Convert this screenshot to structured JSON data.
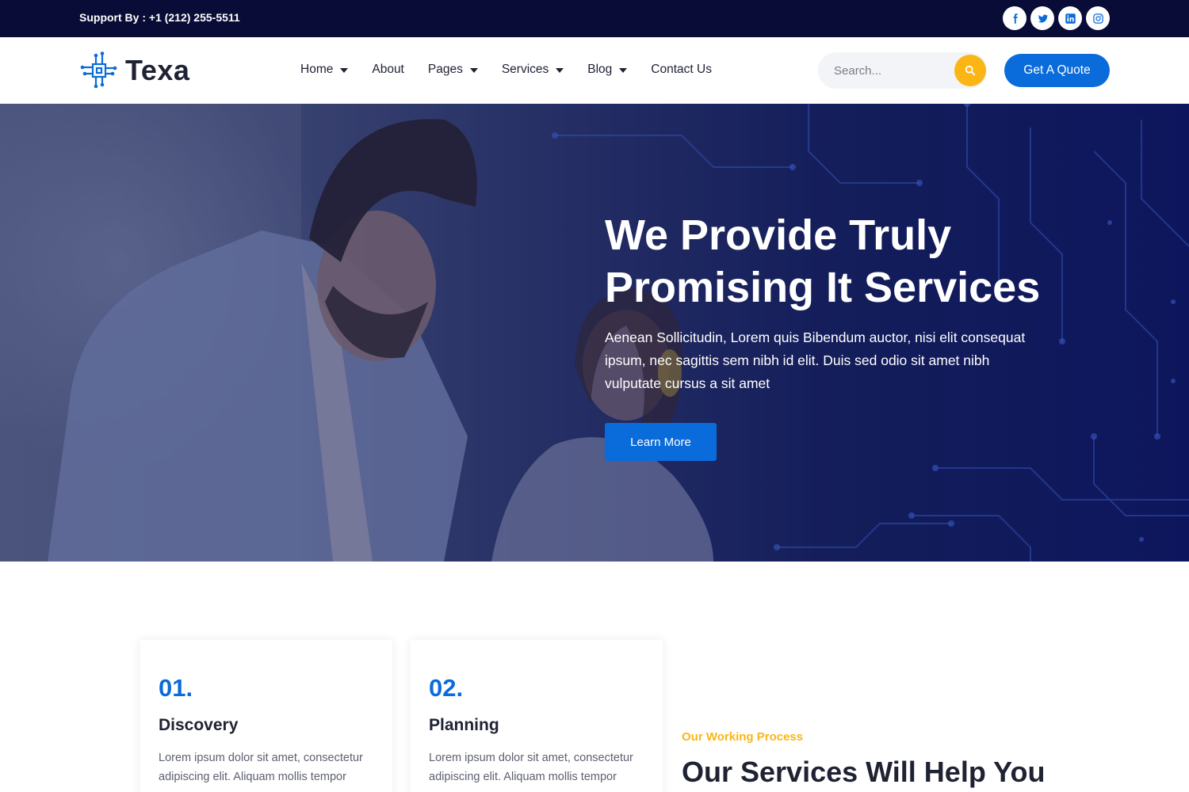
{
  "topbar": {
    "support": "Support By : +1 (212) 255-5511",
    "socials": [
      "facebook-icon",
      "twitter-icon",
      "linkedin-icon",
      "instagram-icon"
    ]
  },
  "nav": {
    "logo_text": "Texa",
    "menu": [
      {
        "label": "Home",
        "dropdown": true
      },
      {
        "label": "About",
        "dropdown": false
      },
      {
        "label": "Pages",
        "dropdown": true
      },
      {
        "label": "Services",
        "dropdown": true
      },
      {
        "label": "Blog",
        "dropdown": true
      },
      {
        "label": "Contact Us",
        "dropdown": false
      }
    ],
    "search_placeholder": "Search...",
    "quote_label": "Get A Quote"
  },
  "hero": {
    "title_line1": "We Provide Truly",
    "title_line2": "Promising It Services",
    "subtitle": "Aenean Sollicitudin, Lorem quis Bibendum auctor, nisi elit consequat ipsum, nec sagittis sem nibh id elit. Duis sed odio sit amet nibh vulputate cursus a sit amet",
    "button": "Learn More"
  },
  "process": {
    "cards": [
      {
        "num": "01.",
        "title": "Discovery",
        "text": "Lorem ipsum dolor sit amet, consectetur adipiscing elit. Aliquam mollis tempor"
      },
      {
        "num": "02.",
        "title": "Planning",
        "text": "Lorem ipsum dolor sit amet, consectetur adipiscing elit. Aliquam mollis tempor"
      }
    ],
    "eyebrow": "Our Working Process",
    "title": "Our Services Will Help You"
  },
  "colors": {
    "topbar": "#080c36",
    "primary": "#0a6bdb",
    "accent": "#fbb616",
    "dark_text": "#1f2233"
  }
}
